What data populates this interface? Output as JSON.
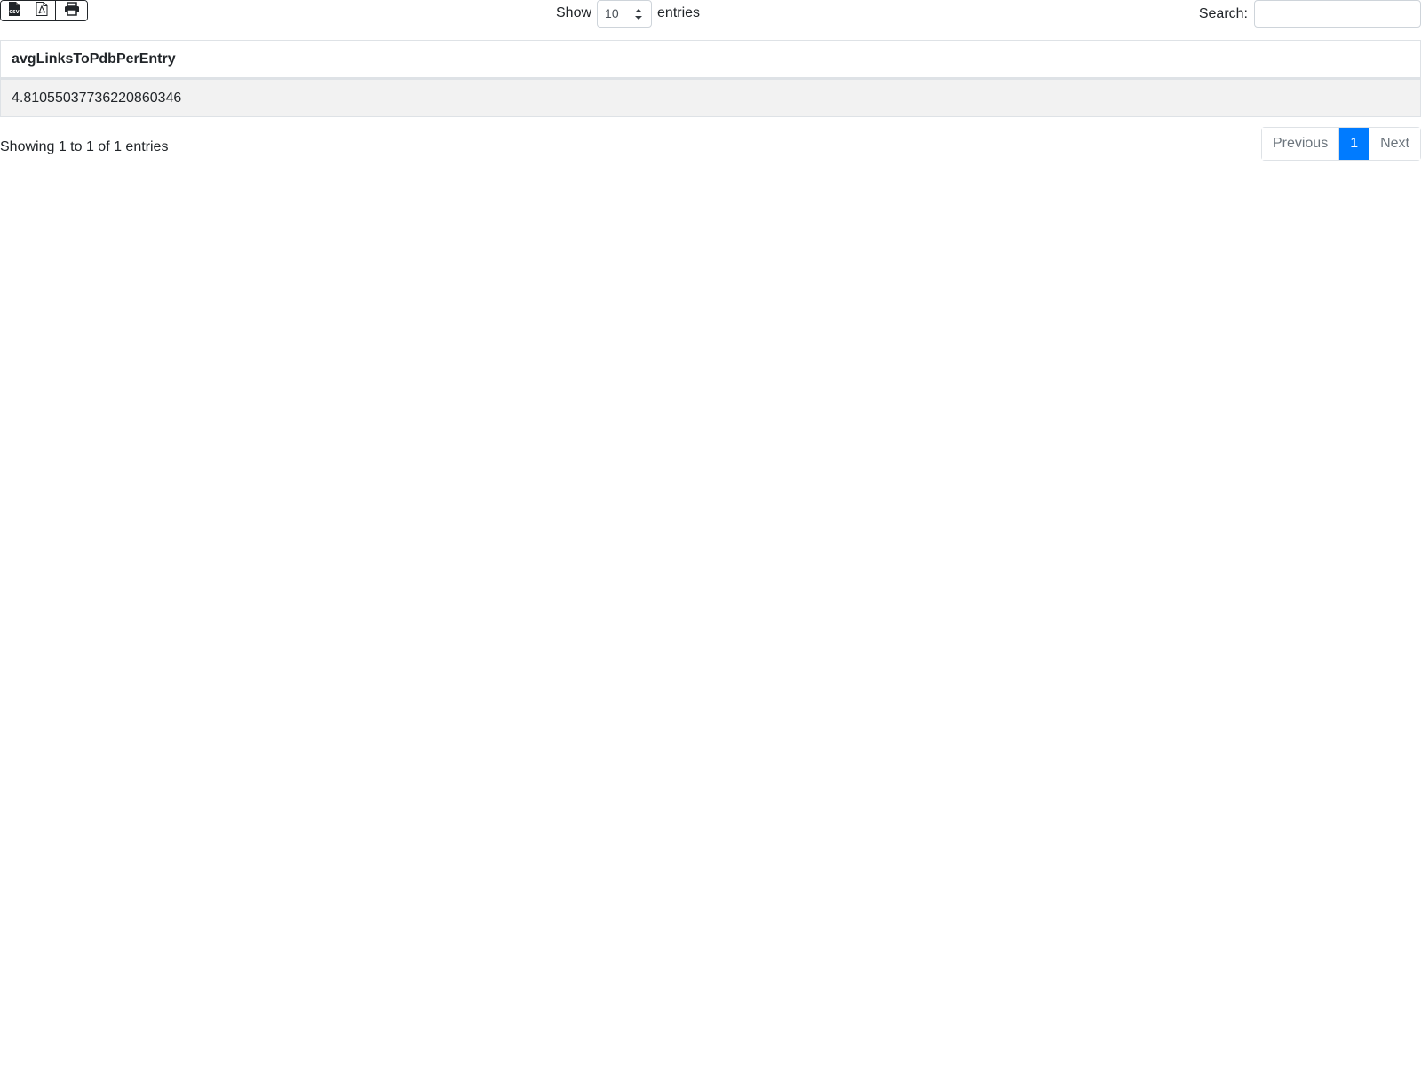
{
  "toolbar": {
    "export_buttons": [
      {
        "icon": "csv-file-icon"
      },
      {
        "icon": "pdf-file-icon"
      },
      {
        "icon": "print-icon"
      }
    ],
    "length_prefix": "Show",
    "length_value": "10",
    "length_suffix": "entries",
    "search_label": "Search:",
    "search_value": ""
  },
  "table": {
    "columns": [
      "avgLinksToPdbPerEntry"
    ],
    "rows": [
      [
        "4.81055037736220860346"
      ]
    ]
  },
  "footer": {
    "info": "Showing 1 to 1 of 1 entries",
    "previous_label": "Previous",
    "current_page": "1",
    "next_label": "Next"
  },
  "colors": {
    "accent": "#007bff",
    "striped_row": "#f2f2f2",
    "border": "#dee2e6"
  }
}
